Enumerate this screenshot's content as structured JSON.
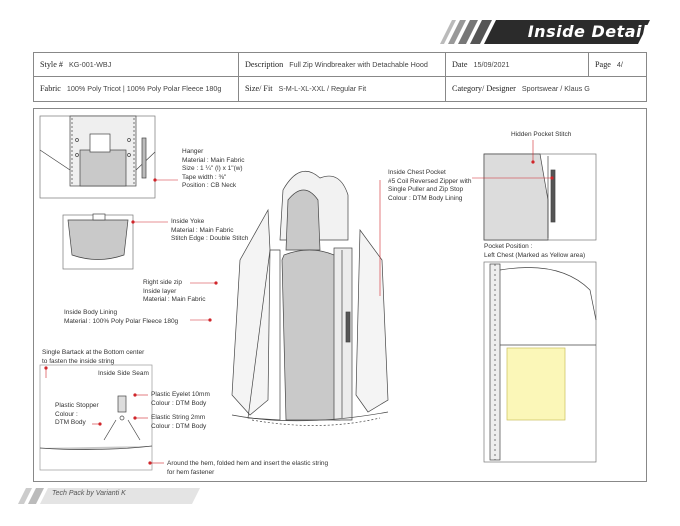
{
  "header": {
    "title": "Inside Detail"
  },
  "info": {
    "style_label": "Style #",
    "style_value": "KG-001-WBJ",
    "description_label": "Description",
    "description_value": "Full Zip Windbreaker with Detachable Hood",
    "date_label": "Date",
    "date_value": "15/09/2021",
    "page_label": "Page",
    "page_value": "4/",
    "fabric_label": "Fabric",
    "fabric_value": "100% Poly Tricot | 100% Poly Polar Fleece 180g",
    "size_label": "Size/ Fit",
    "size_value": "S-M-L-XL-XXL / Regular Fit",
    "category_label": "Category/ Designer",
    "category_value": "Sportswear / Klaus G"
  },
  "notes": {
    "hanger": [
      "Hanger",
      "Material : Main Fabric",
      "Size : 1 ¼\" (l) x 1\"(w)",
      "Tape width : ⅜\"",
      "Position : CB Neck"
    ],
    "inside_yoke": [
      "Inside Yoke",
      "Material : Main Fabric",
      "Stitch Edge : Double Stitch"
    ],
    "right_side_zip": [
      "Right side zip",
      "Inside layer",
      "Material : Main Fabric"
    ],
    "body_lining": [
      "Inside Body Lining",
      "Material : 100% Poly Polar Fleece 180g"
    ],
    "bartack": [
      "Single Bartack at the Bottom center",
      "to fasten the inside string"
    ],
    "side_seam": [
      "Inside Side Seam"
    ],
    "stopper": [
      "Plastic Stopper",
      "Colour :",
      "DTM Body"
    ],
    "eyelet": [
      "Plastic Eyelet 10mm",
      "Colour : DTM Body"
    ],
    "string": [
      "Elastic String 2mm",
      "Colour : DTM Body"
    ],
    "hem": [
      "Around the hem, folded hem and insert the elastic string",
      "for hem fastener"
    ],
    "hidden_pocket": [
      "Hidden Pocket Stitch"
    ],
    "chest_pocket": [
      "Inside Chest Pocket",
      "#5 Coil Reversed Zipper with",
      "Single Puller and Zip Stop",
      "Colour : DTM Body Lining"
    ],
    "pocket_position": [
      "Pocket Position :",
      "Left Chest (Marked as Yellow area)"
    ]
  },
  "colors": {
    "accent_red": "#d0262b",
    "lining_gray": "#c9c9c9",
    "pocket_yellow": "#fbf7b8",
    "banner_dark": "#2b2b2b"
  },
  "footer": {
    "text": "Tech Pack by Varianti K"
  }
}
